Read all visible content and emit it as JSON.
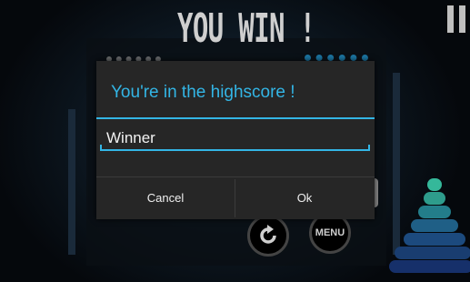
{
  "game": {
    "title": "YOU WIN !"
  },
  "controls": {
    "pause_icon": "pause-icon",
    "restart_icon": "restart-icon",
    "menu_label": "MENU"
  },
  "dialog": {
    "title": "You're in the highscore !",
    "name_value": "Winner",
    "cancel_label": "Cancel",
    "ok_label": "Ok"
  },
  "colors": {
    "accent": "#33b5e5",
    "dialog_bg": "#262626",
    "disk_colors": [
      "#35b89a",
      "#2e9c8c",
      "#237d8a",
      "#1f5f86",
      "#1c4a7e",
      "#193d70",
      "#16306a"
    ]
  }
}
